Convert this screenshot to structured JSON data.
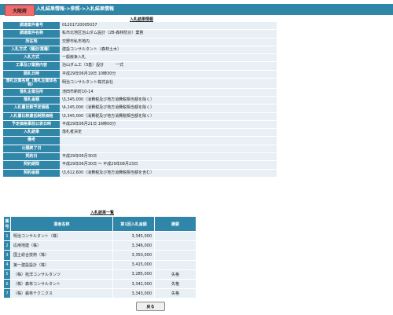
{
  "header": {
    "region_badge": "大阪府",
    "breadcrumb": "入札結果情報->参照->入札結果情報"
  },
  "detail": {
    "title": "入札結果情報",
    "rows": [
      {
        "label": "調達案件番号",
        "value": "01201720005037"
      },
      {
        "label": "調達案件名称",
        "value": "私市北地区治山ダム設計（2B-森林防災）業務"
      },
      {
        "label": "所在地",
        "value": "交野市私市地内"
      },
      {
        "label": "入札方式（種別/業種）",
        "value": "建設コンサルタント（森林土木）"
      },
      {
        "label": "入札方式",
        "value": "一般競争入札"
      },
      {
        "label": "工事及び業務内容",
        "value": "治山ダム工（3基）設計　　　一式"
      },
      {
        "label": "開札日時",
        "value": "平成29年06月19日 10時30分"
      },
      {
        "label": "落札企業名称（落札企業体名称）",
        "value": "明治コンサルタント株式会社"
      },
      {
        "label": "落札企業住所",
        "value": "池田市新町10-14"
      },
      {
        "label": "落札金額",
        "value": "\\3,345,000（消費税及び地方消費税相当額を除く）"
      },
      {
        "label": "入札書比較予定価格",
        "value": "\\4,245,000（消費税及び地方消費税相当額を除く）"
      },
      {
        "label": "入札書比較最低制限価格",
        "value": "\\3,345,000（消費税及び地方消費税相当額を除く）"
      },
      {
        "label": "予定価格事前公表日時",
        "value": "平成29年06月21日 16時00分"
      },
      {
        "label": "入札結果",
        "value": "落札者決定"
      },
      {
        "label": "備考",
        "value": ""
      },
      {
        "label": "公開終了日",
        "value": ""
      },
      {
        "label": "契約日",
        "value": "平成29年06月30日"
      },
      {
        "label": "契約期間",
        "value": "平成29年06月30日 ～ 平成29年08月23日"
      },
      {
        "label": "契約金額",
        "value": "\\3,612,600（消費税及び地方消費税相当額を含む）"
      }
    ]
  },
  "results": {
    "title": "入札結果一覧",
    "headers": {
      "no": "番号",
      "name": "業者名称",
      "amount": "第1回入札金額",
      "note": "摘要"
    },
    "rows": [
      {
        "no": "1",
        "name": "明治コンサルタント（株）",
        "amount": "3,345,000",
        "note": ""
      },
      {
        "no": "2",
        "name": "応用地建（株）",
        "amount": "3,346,000",
        "note": ""
      },
      {
        "no": "3",
        "name": "国土総合技術（株）",
        "amount": "3,350,000",
        "note": ""
      },
      {
        "no": "4",
        "name": "第一建設設計（株）",
        "amount": "3,415,000",
        "note": ""
      },
      {
        "no": "5",
        "name": "（株）拓洋コンサルタンツ",
        "amount": "3,285,000",
        "note": "失格"
      },
      {
        "no": "6",
        "name": "（株）森林コンサルタント",
        "amount": "3,342,000",
        "note": "失格"
      },
      {
        "no": "7",
        "name": "（株）森林テクニクス",
        "amount": "3,343,000",
        "note": "失格"
      }
    ]
  },
  "actions": {
    "back_label": "戻る"
  }
}
